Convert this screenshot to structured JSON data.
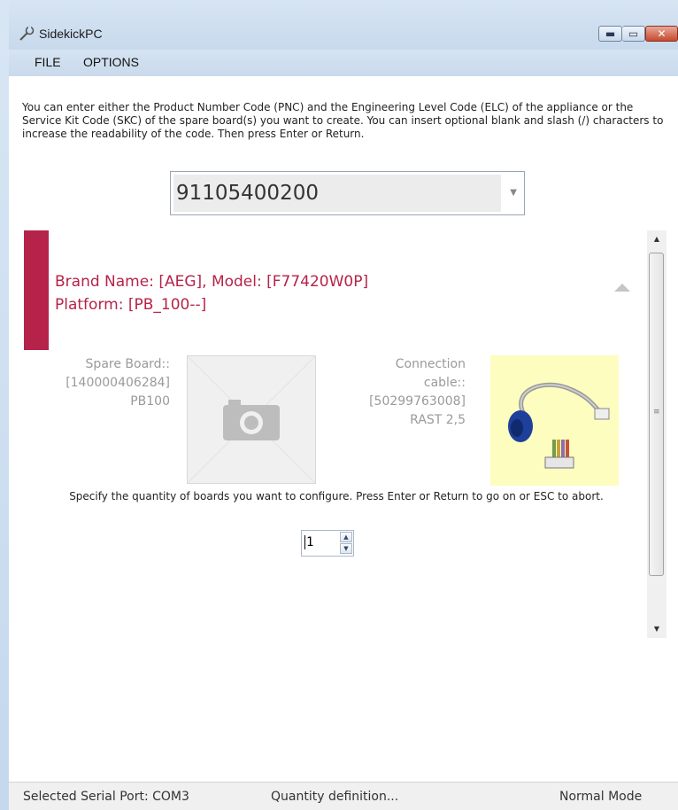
{
  "window": {
    "title": "SidekickPC",
    "minimize_glyph": "▬",
    "maximize_glyph": "▭",
    "close_glyph": "✕",
    "app_icon": "wrench-icon"
  },
  "menu": {
    "items": [
      "FILE",
      "OPTIONS"
    ]
  },
  "instructions": "You can enter either the Product Number Code (PNC) and the Engineering Level Code (ELC) of the appliance or the Service Kit Code (SKC) of the spare board(s) you want to create.  You can insert optional blank and slash (/) characters to increase the readability of the code.  Then press Enter or Return.",
  "code_input": {
    "value": "91105400200",
    "arrow_icon": "chevron-down-icon"
  },
  "product": {
    "line1": "Brand Name: [AEG], Model: [F77420W0P]",
    "line2": "Platform: [PB_100--]",
    "accent_color": "#b6234a"
  },
  "spare_board": {
    "line1": "Spare Board::",
    "line2": "[140000406284]",
    "line3": "PB100",
    "image_icon": "camera-icon"
  },
  "connection_cable": {
    "line1": "Connection",
    "line2": "cable::",
    "line3": "[50299763008]",
    "line4": "RAST 2,5"
  },
  "quantity": {
    "prompt": "Specify the quantity of boards you want to configure.  Press Enter or Return to go on or ESC to abort.",
    "value": "1"
  },
  "scrollbar": {
    "up_glyph": "▲",
    "down_glyph": "▼",
    "grip_glyph": "≡"
  },
  "status": {
    "port": "Selected Serial Port: COM3",
    "state": "Quantity definition...",
    "mode": "Normal Mode"
  }
}
